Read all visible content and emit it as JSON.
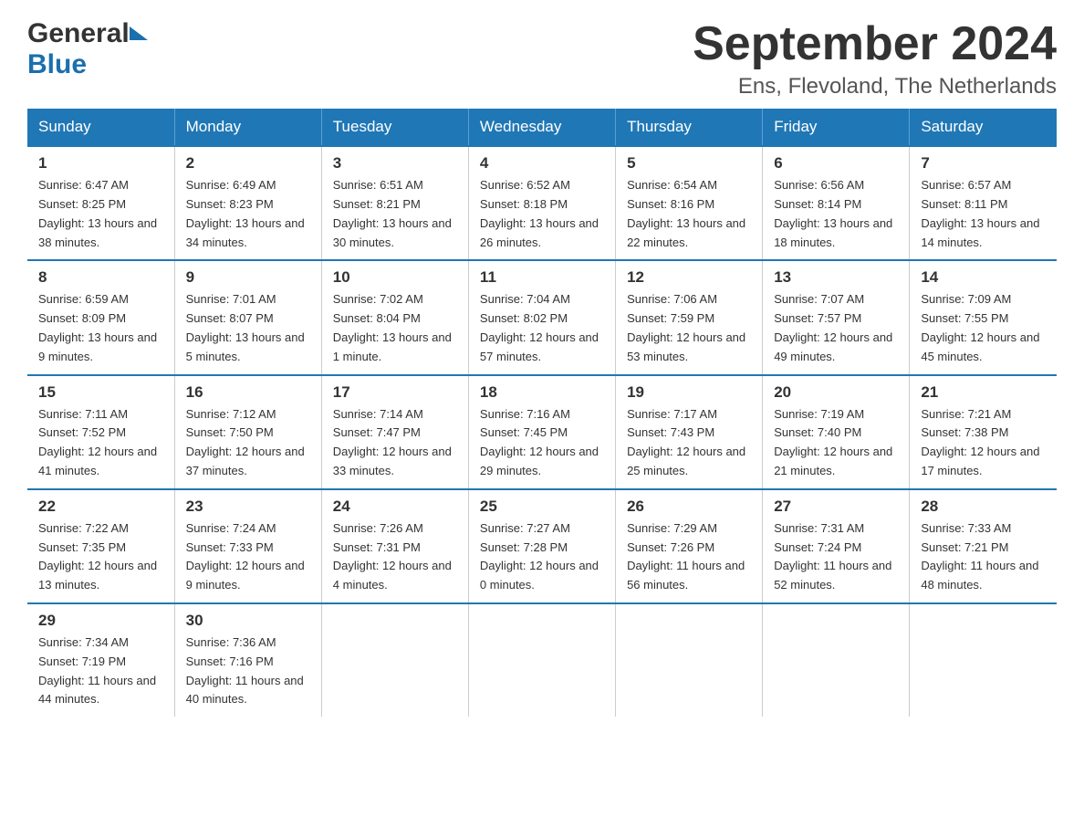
{
  "header": {
    "month_year": "September 2024",
    "location": "Ens, Flevoland, The Netherlands",
    "logo_general": "General",
    "logo_blue": "Blue"
  },
  "days_of_week": [
    "Sunday",
    "Monday",
    "Tuesday",
    "Wednesday",
    "Thursday",
    "Friday",
    "Saturday"
  ],
  "weeks": [
    [
      {
        "day": "1",
        "sunrise": "Sunrise: 6:47 AM",
        "sunset": "Sunset: 8:25 PM",
        "daylight": "Daylight: 13 hours and 38 minutes."
      },
      {
        "day": "2",
        "sunrise": "Sunrise: 6:49 AM",
        "sunset": "Sunset: 8:23 PM",
        "daylight": "Daylight: 13 hours and 34 minutes."
      },
      {
        "day": "3",
        "sunrise": "Sunrise: 6:51 AM",
        "sunset": "Sunset: 8:21 PM",
        "daylight": "Daylight: 13 hours and 30 minutes."
      },
      {
        "day": "4",
        "sunrise": "Sunrise: 6:52 AM",
        "sunset": "Sunset: 8:18 PM",
        "daylight": "Daylight: 13 hours and 26 minutes."
      },
      {
        "day": "5",
        "sunrise": "Sunrise: 6:54 AM",
        "sunset": "Sunset: 8:16 PM",
        "daylight": "Daylight: 13 hours and 22 minutes."
      },
      {
        "day": "6",
        "sunrise": "Sunrise: 6:56 AM",
        "sunset": "Sunset: 8:14 PM",
        "daylight": "Daylight: 13 hours and 18 minutes."
      },
      {
        "day": "7",
        "sunrise": "Sunrise: 6:57 AM",
        "sunset": "Sunset: 8:11 PM",
        "daylight": "Daylight: 13 hours and 14 minutes."
      }
    ],
    [
      {
        "day": "8",
        "sunrise": "Sunrise: 6:59 AM",
        "sunset": "Sunset: 8:09 PM",
        "daylight": "Daylight: 13 hours and 9 minutes."
      },
      {
        "day": "9",
        "sunrise": "Sunrise: 7:01 AM",
        "sunset": "Sunset: 8:07 PM",
        "daylight": "Daylight: 13 hours and 5 minutes."
      },
      {
        "day": "10",
        "sunrise": "Sunrise: 7:02 AM",
        "sunset": "Sunset: 8:04 PM",
        "daylight": "Daylight: 13 hours and 1 minute."
      },
      {
        "day": "11",
        "sunrise": "Sunrise: 7:04 AM",
        "sunset": "Sunset: 8:02 PM",
        "daylight": "Daylight: 12 hours and 57 minutes."
      },
      {
        "day": "12",
        "sunrise": "Sunrise: 7:06 AM",
        "sunset": "Sunset: 7:59 PM",
        "daylight": "Daylight: 12 hours and 53 minutes."
      },
      {
        "day": "13",
        "sunrise": "Sunrise: 7:07 AM",
        "sunset": "Sunset: 7:57 PM",
        "daylight": "Daylight: 12 hours and 49 minutes."
      },
      {
        "day": "14",
        "sunrise": "Sunrise: 7:09 AM",
        "sunset": "Sunset: 7:55 PM",
        "daylight": "Daylight: 12 hours and 45 minutes."
      }
    ],
    [
      {
        "day": "15",
        "sunrise": "Sunrise: 7:11 AM",
        "sunset": "Sunset: 7:52 PM",
        "daylight": "Daylight: 12 hours and 41 minutes."
      },
      {
        "day": "16",
        "sunrise": "Sunrise: 7:12 AM",
        "sunset": "Sunset: 7:50 PM",
        "daylight": "Daylight: 12 hours and 37 minutes."
      },
      {
        "day": "17",
        "sunrise": "Sunrise: 7:14 AM",
        "sunset": "Sunset: 7:47 PM",
        "daylight": "Daylight: 12 hours and 33 minutes."
      },
      {
        "day": "18",
        "sunrise": "Sunrise: 7:16 AM",
        "sunset": "Sunset: 7:45 PM",
        "daylight": "Daylight: 12 hours and 29 minutes."
      },
      {
        "day": "19",
        "sunrise": "Sunrise: 7:17 AM",
        "sunset": "Sunset: 7:43 PM",
        "daylight": "Daylight: 12 hours and 25 minutes."
      },
      {
        "day": "20",
        "sunrise": "Sunrise: 7:19 AM",
        "sunset": "Sunset: 7:40 PM",
        "daylight": "Daylight: 12 hours and 21 minutes."
      },
      {
        "day": "21",
        "sunrise": "Sunrise: 7:21 AM",
        "sunset": "Sunset: 7:38 PM",
        "daylight": "Daylight: 12 hours and 17 minutes."
      }
    ],
    [
      {
        "day": "22",
        "sunrise": "Sunrise: 7:22 AM",
        "sunset": "Sunset: 7:35 PM",
        "daylight": "Daylight: 12 hours and 13 minutes."
      },
      {
        "day": "23",
        "sunrise": "Sunrise: 7:24 AM",
        "sunset": "Sunset: 7:33 PM",
        "daylight": "Daylight: 12 hours and 9 minutes."
      },
      {
        "day": "24",
        "sunrise": "Sunrise: 7:26 AM",
        "sunset": "Sunset: 7:31 PM",
        "daylight": "Daylight: 12 hours and 4 minutes."
      },
      {
        "day": "25",
        "sunrise": "Sunrise: 7:27 AM",
        "sunset": "Sunset: 7:28 PM",
        "daylight": "Daylight: 12 hours and 0 minutes."
      },
      {
        "day": "26",
        "sunrise": "Sunrise: 7:29 AM",
        "sunset": "Sunset: 7:26 PM",
        "daylight": "Daylight: 11 hours and 56 minutes."
      },
      {
        "day": "27",
        "sunrise": "Sunrise: 7:31 AM",
        "sunset": "Sunset: 7:24 PM",
        "daylight": "Daylight: 11 hours and 52 minutes."
      },
      {
        "day": "28",
        "sunrise": "Sunrise: 7:33 AM",
        "sunset": "Sunset: 7:21 PM",
        "daylight": "Daylight: 11 hours and 48 minutes."
      }
    ],
    [
      {
        "day": "29",
        "sunrise": "Sunrise: 7:34 AM",
        "sunset": "Sunset: 7:19 PM",
        "daylight": "Daylight: 11 hours and 44 minutes."
      },
      {
        "day": "30",
        "sunrise": "Sunrise: 7:36 AM",
        "sunset": "Sunset: 7:16 PM",
        "daylight": "Daylight: 11 hours and 40 minutes."
      },
      null,
      null,
      null,
      null,
      null
    ]
  ]
}
